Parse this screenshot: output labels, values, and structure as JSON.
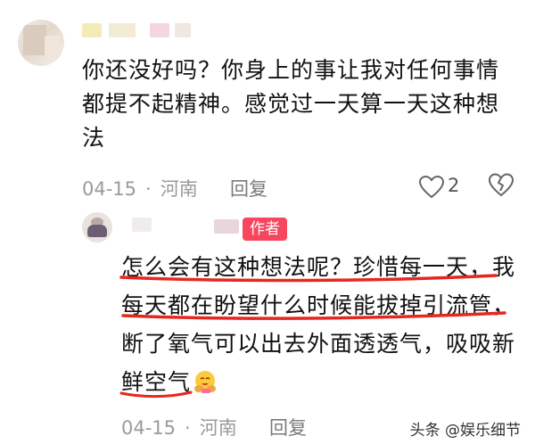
{
  "comments": [
    {
      "text_lines": [
        "你还没好吗？你身上的事让我对任何事情",
        "都提不起精神。感觉过一天算一天这种想",
        "法"
      ],
      "date": "04-15",
      "separator": "·",
      "location": "河南",
      "reply_label": "回复",
      "like_count": "2"
    },
    {
      "author_badge": "作者",
      "text_lines": [
        "怎么会有这种想法呢？珍惜每一天，我",
        "每天都在盼望什么时候能拔掉引流管，",
        "断了氧气可以出去外面透透气，吸吸新",
        "鲜空气"
      ],
      "date": "04-15",
      "separator": "·",
      "location": "河南",
      "reply_label": "回复"
    }
  ],
  "watermark": "头条 @娱乐细节",
  "colors": {
    "author_badge": "#f7475f",
    "annotation_red": "#e5281f",
    "meta_gray": "#9a9a9a"
  },
  "icons": [
    "heart-icon",
    "dislike-icon",
    "hug-emoji"
  ]
}
